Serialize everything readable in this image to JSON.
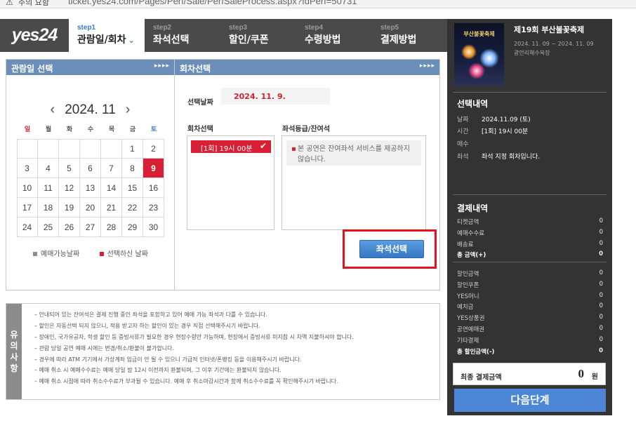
{
  "browser": {
    "security_label": "주의 요함",
    "url": "ticket.yes24.com/Pages/Perf/Sale/PerfSaleProcess.aspx?IdPerf=50731"
  },
  "header": {
    "logo": "yes24",
    "steps": [
      {
        "num": "step1",
        "label": "관람일/회차",
        "active": true
      },
      {
        "num": "step2",
        "label": "좌석선택"
      },
      {
        "num": "step3",
        "label": "할인/쿠폰"
      },
      {
        "num": "step4",
        "label": "수령방법"
      },
      {
        "num": "step5",
        "label": "결제방법"
      }
    ]
  },
  "calendar": {
    "title": "관람일 선택",
    "month": "2024. 11",
    "weekdays": [
      "일",
      "월",
      "화",
      "수",
      "목",
      "금",
      "토"
    ],
    "weekday_colors": [
      "#d1232f",
      "#555555",
      "#555555",
      "#555555",
      "#555555",
      "#555555",
      "#3c7cc8"
    ],
    "first_weekday": 5,
    "days": 30,
    "selected_day": 9,
    "legend_available": "예매가능날짜",
    "legend_selected": "선택하신 날짜",
    "legend_available_color": "#8c8c8c",
    "legend_selected_color": "#d91f35"
  },
  "session": {
    "title": "회차선택",
    "date_label": "선택날짜",
    "date_value": "2024. 11. 9.",
    "session_label": "회차선택",
    "session_item": "[1회] 19시 00분",
    "grade_label": "좌석등급/잔여석",
    "grade_info": "본 공연은 잔여좌석 서비스를 제공하지 않습니다.",
    "seat_button": "좌석선택"
  },
  "notice": {
    "side_label": [
      "유",
      "의",
      "사",
      "항"
    ],
    "lines": [
      "– 안내되어 있는 잔여석은 결제 진행 중인 좌석을 포함하고 있어 예매 가능 좌석과 다를 수 있습니다.",
      "– 할인은 자동선택 되지 않으니, 적용 받고자 하는 할인이 있는 경우 직접 선택해주시기 바랍니다.",
      "– 장애인, 국가유공자, 학생 할인 등 증빙서류가 필요한 경우 현장수령만 가능하며, 현장에서 증빙서류 미지참 시 차액 지불하셔야 합니다.",
      "– 관람 당일 공연 예매 시에는 변경/취소/환불이 불가합니다.",
      "– 경우에 따라 ATM 기기에서 가상계좌 입금이 안 될 수 있으니 가급적 인터넷/폰뱅킹 등을 이용해주시기 바랍니다.",
      "– 예매 취소 시 예매수수료는 예매 당일 밤 12시 이전까지 환불되며, 그 이후 기간에는 환불되지 않습니다.",
      "– 예매 취소 시점에 따라 취소수수료가 부과될 수 있습니다. 예매 후 취소마감시간과 함께 취소수수료를 꼭 확인해주시기 바랍니다."
    ]
  },
  "sidebar": {
    "poster_title": "부산불꽃축제",
    "show_title": "제19회 부산불꽃축제",
    "show_dates": "2024. 11. 09 ~ 2024. 11. 09",
    "show_venue": "광안리해수욕장",
    "selection_title": "선택내역",
    "selection": [
      {
        "label": "날짜",
        "value": "2024.11.09 (토)"
      },
      {
        "label": "시간",
        "value": "[1회] 19시 00분"
      },
      {
        "label": "매수",
        "value": ""
      },
      {
        "label": "좌석",
        "value": "좌석 지정 회차입니다."
      }
    ],
    "payment_title": "결제내역",
    "payment_group1": [
      {
        "label": "티켓금액",
        "amount": "0"
      },
      {
        "label": "예매수수료",
        "amount": "0"
      },
      {
        "label": "배송료",
        "amount": "0"
      },
      {
        "label": "총 금액(+)",
        "amount": "0",
        "bold": true
      }
    ],
    "payment_group2": [
      {
        "label": "할인금액",
        "amount": "0"
      },
      {
        "label": "할인쿠폰",
        "amount": "0"
      },
      {
        "label": "YES머니",
        "amount": "0"
      },
      {
        "label": "예치금",
        "amount": "0"
      },
      {
        "label": "YES상품권",
        "amount": "0"
      },
      {
        "label": "공연예매권",
        "amount": "0"
      },
      {
        "label": "기타결제",
        "amount": "0"
      },
      {
        "label": "총 할인금액(-)",
        "amount": "0",
        "bold": true
      }
    ],
    "total_label": "최종 결제금액",
    "total_amount": "0",
    "total_unit": "원",
    "next_button": "다음단계"
  }
}
